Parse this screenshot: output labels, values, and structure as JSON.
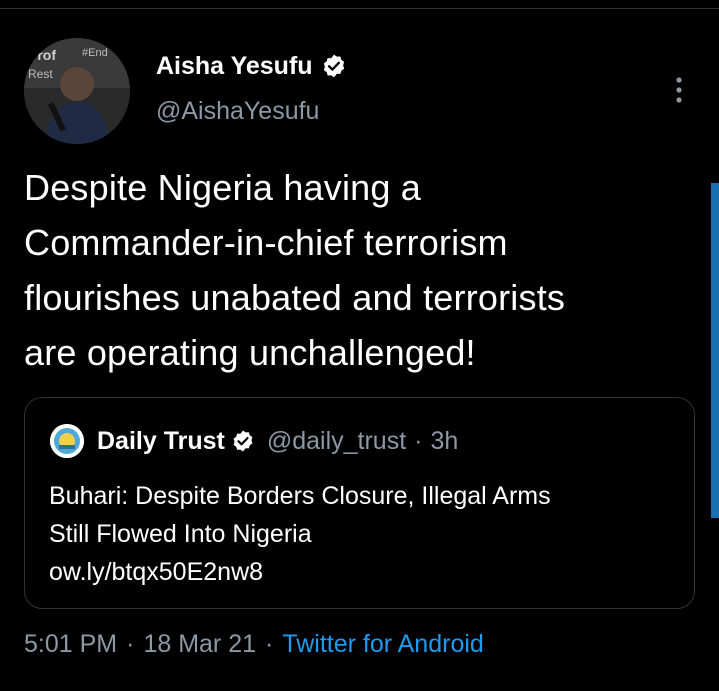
{
  "author": {
    "name": "Aisha Yesufu",
    "handle": "@AishaYesufu",
    "verified": true,
    "avatar_icon": "profile-photo"
  },
  "tweet": {
    "text_lines": [
      "Despite Nigeria having a",
      "Commander-in-chief terrorism",
      "flourishes unabated and terrorists",
      "are operating unchallenged!"
    ]
  },
  "quoted_tweet": {
    "name": "Daily Trust",
    "handle": "@daily_trust",
    "separator": "·",
    "time": "3h",
    "verified": true,
    "body_lines": [
      "Buhari: Despite Borders Closure, Illegal Arms",
      "Still Flowed Into Nigeria",
      "ow.ly/btqx50E2nw8"
    ]
  },
  "meta": {
    "time": "5:01 PM",
    "separator": "·",
    "date": "18 Mar 21",
    "source": "Twitter for Android"
  },
  "colors": {
    "background": "#000000",
    "text": "#ffffff",
    "secondary": "#8b98a5",
    "link": "#1d9bf0",
    "border": "#2f3336"
  },
  "icons": {
    "verified": "verified-badge-icon",
    "more": "more-options-icon"
  }
}
